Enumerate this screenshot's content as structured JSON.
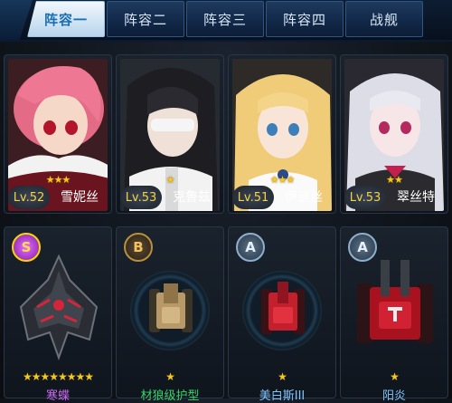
{
  "tabs": [
    "阵容一",
    "阵容二",
    "阵容三",
    "阵容四",
    "战舰"
  ],
  "characters": [
    {
      "level": "Lv.52",
      "name": "雪妮丝",
      "stars": "★★★"
    },
    {
      "level": "Lv.53",
      "name": "克鲁兹",
      "stars": "★"
    },
    {
      "level": "Lv.51",
      "name": "伊迪丝",
      "stars": "★★★"
    },
    {
      "level": "Lv.53",
      "name": "翠丝特",
      "stars": "★★"
    }
  ],
  "ships": [
    {
      "rank": "S",
      "stars": "★★★★★★★★",
      "name": "寒蝶",
      "name_color": "#c86af0"
    },
    {
      "rank": "B",
      "stars": "★",
      "name": "材狼级护型",
      "name_color": "#39d26b"
    },
    {
      "rank": "A",
      "stars": "★",
      "name": "美白斯III",
      "name_color": "#7fc4ff"
    },
    {
      "rank": "A",
      "stars": "★",
      "name": "阳炎",
      "name_color": "#7fc4ff"
    }
  ],
  "colors": {
    "accent": "#1a6fb0",
    "star": "#f6c81c",
    "level": "#f4d24a"
  }
}
